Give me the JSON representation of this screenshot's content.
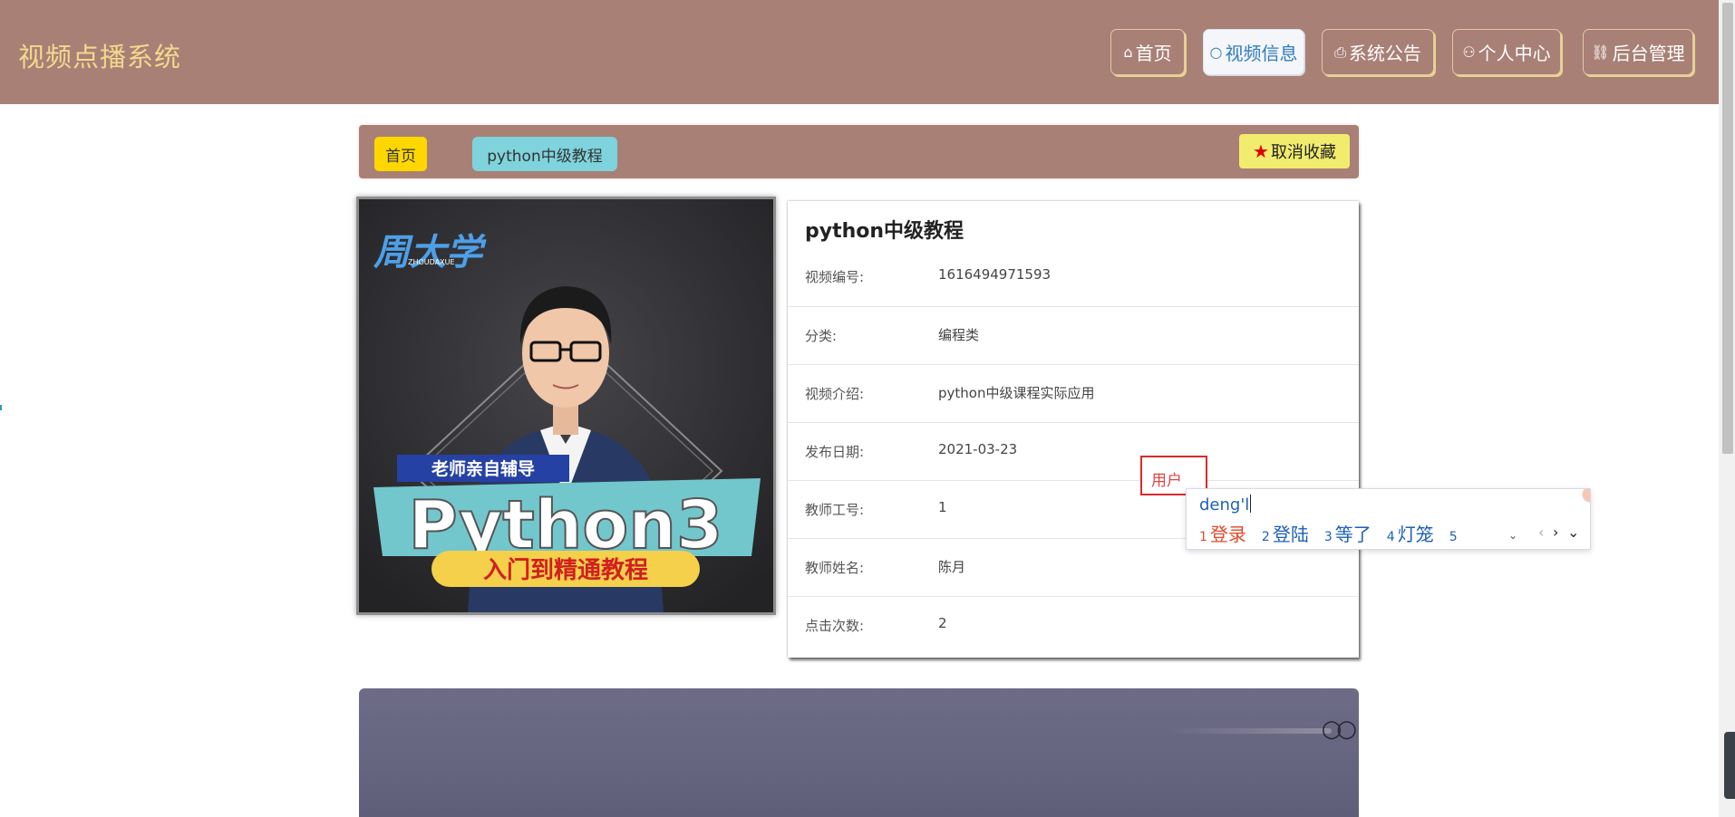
{
  "header": {
    "brand": "视频点播系统",
    "nav": [
      {
        "label": "首页",
        "icon": "home-icon",
        "glyph": "⌂"
      },
      {
        "label": "视频信息",
        "icon": "circle-icon",
        "glyph": "○"
      },
      {
        "label": "系统公告",
        "icon": "printer-icon",
        "glyph": "⎙"
      },
      {
        "label": "个人中心",
        "icon": "user-icon",
        "glyph": "⚇"
      },
      {
        "label": "后台管理",
        "icon": "link-icon",
        "glyph": "🔗"
      }
    ]
  },
  "breadcrumb": {
    "home": "首页",
    "current": "python中级教程",
    "favorite_label": "取消收藏"
  },
  "poster": {
    "logo_text": "周大学",
    "logo_sub": "ZHOUDAXUE",
    "tag": "老师亲自辅导",
    "headline": "Python3",
    "subline": "入门到精通教程"
  },
  "details": {
    "title": "python中级教程",
    "rows": [
      {
        "label": "视频编号:",
        "value": "1616494971593"
      },
      {
        "label": "分类:",
        "value": "编程类"
      },
      {
        "label": "视频介绍:",
        "value": "python中级课程实际应用"
      },
      {
        "label": "发布日期:",
        "value": "2021-03-23"
      },
      {
        "label": "教师工号:",
        "value": "1"
      },
      {
        "label": "教师姓名:",
        "value": "陈月"
      },
      {
        "label": "点击次数:",
        "value": "2"
      }
    ]
  },
  "ime": {
    "composing_box": "用户",
    "input": "deng'l",
    "candidates": [
      {
        "n": "1",
        "text": "登录"
      },
      {
        "n": "2",
        "text": "登陆"
      },
      {
        "n": "3",
        "text": "等了"
      },
      {
        "n": "4",
        "text": "灯笼"
      },
      {
        "n": "5",
        "text": ""
      }
    ]
  },
  "colors": {
    "header_bg": "#a88076",
    "brand": "#f3d88d",
    "active_nav_text": "#2f7bc0",
    "breadcrumb_home": "#ffd700",
    "breadcrumb_current": "#7fd3dc",
    "favorite_button": "#f2ec6e"
  }
}
